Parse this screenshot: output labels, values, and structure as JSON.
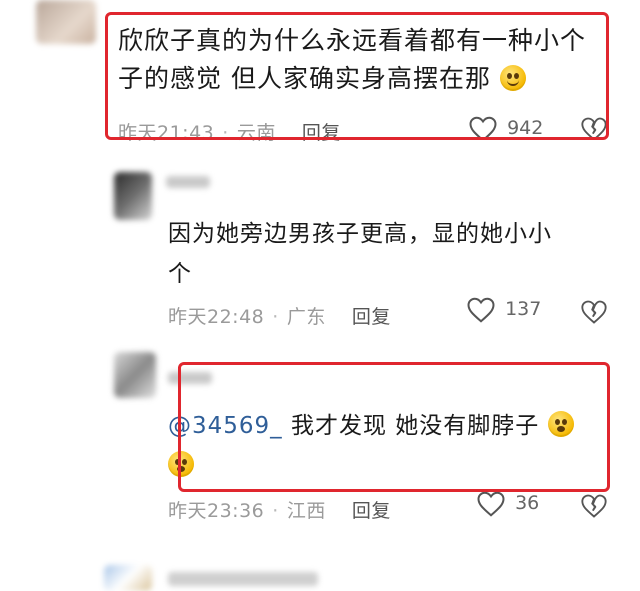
{
  "comment1": {
    "text_line1": "欣欣子真的为什么永远看着都有一种小个",
    "text_line2": "子的感觉 但人家确实身高摆在那",
    "time": "昨天21:43",
    "location": "云南",
    "reply_label": "回复",
    "likes": "942"
  },
  "reply1": {
    "text_line1": "因为她旁边男孩子更高，显的她小小",
    "text_line2": "个",
    "time": "昨天22:48",
    "location": "广东",
    "reply_label": "回复",
    "likes": "137"
  },
  "reply2": {
    "mention": "@34569_",
    "text": " 我才发现  她没有脚脖子",
    "time": "昨天23:36",
    "location": "江西",
    "reply_label": "回复",
    "likes": "36"
  },
  "colors": {
    "highlight_frame": "#e0262e",
    "mention": "#2f5e98"
  }
}
